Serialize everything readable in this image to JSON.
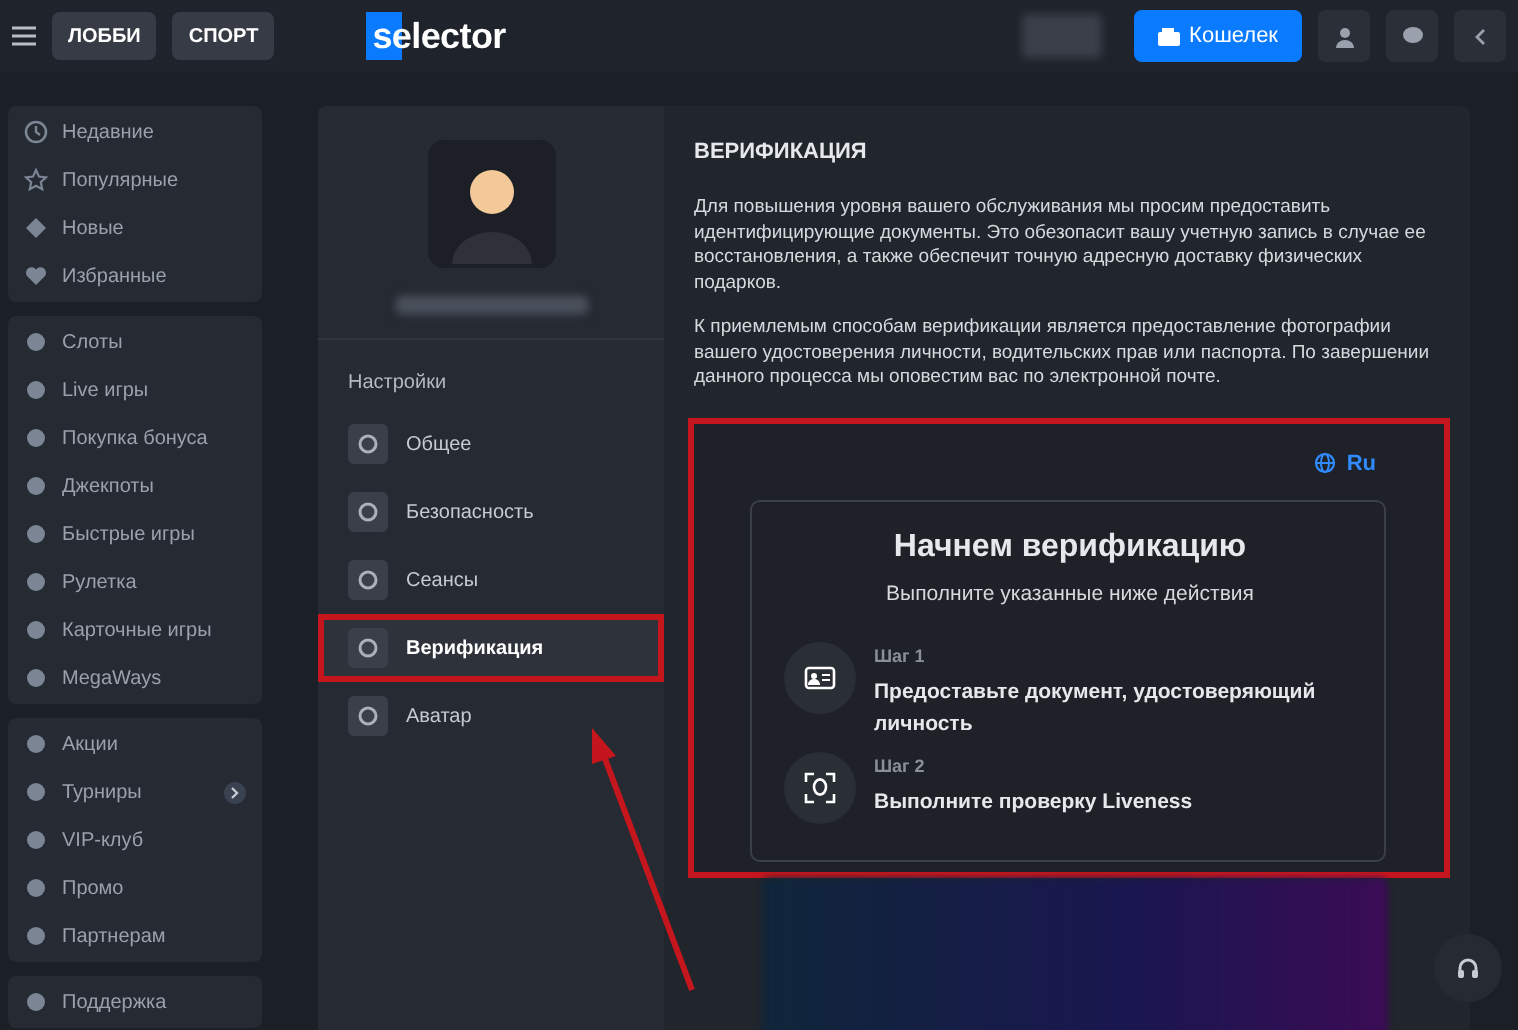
{
  "header": {
    "tabs": [
      {
        "label": "ЛОББИ",
        "selected": false
      },
      {
        "label": "СПОРТ",
        "selected": false
      }
    ],
    "logo": "selector",
    "wallet_button": "Кошелек"
  },
  "sidebar": {
    "groups": [
      {
        "items": [
          {
            "label": "Недавние"
          },
          {
            "label": "Популярные"
          },
          {
            "label": "Новые"
          },
          {
            "label": "Избранные"
          }
        ]
      },
      {
        "items": [
          {
            "label": "Слоты"
          },
          {
            "label": "Live игры"
          },
          {
            "label": "Покупка бонуса"
          },
          {
            "label": "Джекпоты"
          },
          {
            "label": "Быстрые игры"
          },
          {
            "label": "Рулетка"
          },
          {
            "label": "Карточные игры"
          },
          {
            "label": "MegaWays"
          }
        ]
      },
      {
        "items": [
          {
            "label": "Акции"
          },
          {
            "label": "Турниры",
            "expandable": true
          },
          {
            "label": "VIP-клуб"
          },
          {
            "label": "Промо"
          },
          {
            "label": "Партнерам"
          }
        ]
      },
      {
        "items": [
          {
            "label": "Поддержка"
          }
        ]
      }
    ]
  },
  "settings": {
    "heading": "Настройки",
    "items": [
      {
        "label": "Общее",
        "selected": false,
        "highlighted": false
      },
      {
        "label": "Безопасность",
        "selected": false,
        "highlighted": false
      },
      {
        "label": "Сеансы",
        "selected": false,
        "highlighted": false
      },
      {
        "label": "Верификация",
        "selected": true,
        "highlighted": true
      },
      {
        "label": "Аватар",
        "selected": false,
        "highlighted": false
      }
    ]
  },
  "verification": {
    "title": "ВЕРИФИКАЦИЯ",
    "paragraphs": [
      "Для повышения уровня вашего обслуживания мы просим предоставить идентифицирующие документы. Это обезопасит вашу учетную запись в случае ее восстановления, а также обеспечит точную адресную доставку физических подарков.",
      "К приемлемым способам верификации является предоставление фотографии вашего удостоверения личности, водительских прав или паспорта. По завершении данного процесса мы оповестим вас по электронной почте."
    ],
    "widget": {
      "highlighted": true,
      "language": "Ru",
      "title": "Начнем верификацию",
      "subtitle": "Выполните указанные ниже действия",
      "steps": [
        {
          "kind": "document",
          "step": "Шаг 1",
          "text": "Предоставьте документ, удостоверяющий личность"
        },
        {
          "kind": "face",
          "step": "Шаг 2",
          "text": "Выполните проверку Liveness"
        }
      ]
    }
  }
}
